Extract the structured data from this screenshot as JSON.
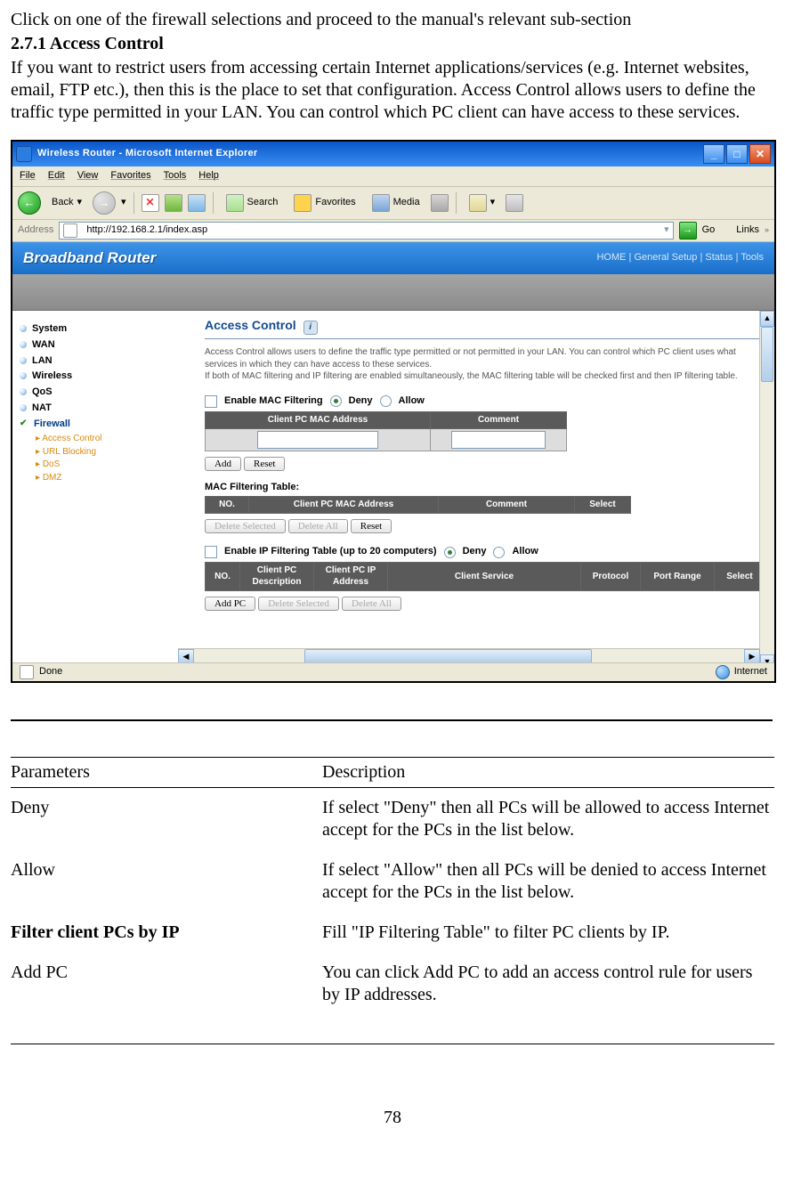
{
  "intro_line": "Click on one of the firewall selections and proceed to the manual's relevant sub-section",
  "heading": "2.7.1 Access Control",
  "paragraph": "If you want to restrict users from accessing certain Internet applications/services (e.g. Internet websites, email, FTP etc.), then this is the place to set that configuration. Access Control allows users to define the traffic type permitted in your LAN. You can control which PC client can have access to these services.",
  "title_bar": "Wireless Router - Microsoft Internet Explorer",
  "menus": {
    "file": "File",
    "edit": "Edit",
    "view": "View",
    "favorites": "Favorites",
    "tools": "Tools",
    "help": "Help"
  },
  "toolbar": {
    "back": "Back",
    "search": "Search",
    "favorites": "Favorites",
    "media": "Media"
  },
  "address": {
    "label": "Address",
    "url": "http://192.168.2.1/index.asp",
    "go": "Go",
    "links": "Links"
  },
  "banner": {
    "title": "Broadband Router",
    "links": "HOME | General Setup | Status | Tools"
  },
  "sidebar": {
    "items": [
      "System",
      "WAN",
      "LAN",
      "Wireless",
      "QoS",
      "NAT"
    ],
    "active": "Firewall",
    "sub": [
      "Access Control",
      "URL Blocking",
      "DoS",
      "DMZ"
    ]
  },
  "section": {
    "title": "Access Control",
    "desc1": "Access Control allows users to define the traffic type permitted or not permitted in your LAN. You can control which PC client uses what services in which they can have access to these services.",
    "desc2": "If both of MAC filtering and IP filtering are enabled simultaneously, the MAC filtering table will be checked first and then IP filtering table.",
    "mac": {
      "enable": "Enable MAC Filtering",
      "deny": "Deny",
      "allow": "Allow",
      "th1": "Client PC MAC Address",
      "th2": "Comment",
      "add": "Add",
      "reset": "Reset",
      "table_label": "MAC Filtering Table:",
      "tth_no": "NO.",
      "tth_addr": "Client PC MAC Address",
      "tth_comment": "Comment",
      "tth_select": "Select",
      "delsel": "Delete Selected",
      "delall": "Delete All",
      "reset2": "Reset"
    },
    "ip": {
      "enable": "Enable IP Filtering Table (up to 20 computers)",
      "deny": "Deny",
      "allow": "Allow",
      "th_no": "NO.",
      "th_desc": "Client PC Description",
      "th_ip": "Client PC IP Address",
      "th_service": "Client Service",
      "th_proto": "Protocol",
      "th_prange": "Port Range",
      "th_select": "Select",
      "addpc": "Add PC",
      "delsel": "Delete Selected",
      "delall": "Delete All"
    }
  },
  "status": {
    "done": "Done",
    "internet": "Internet"
  },
  "param_table": {
    "h1": "Parameters",
    "h2": "Description",
    "rows": [
      {
        "p": "Deny",
        "d": "If select \"Deny\" then all PCs will be allowed to access Internet accept for the PCs in the list below."
      },
      {
        "p": "Allow",
        "d": "If select \"Allow\" then all PCs will be denied to access Internet accept for the PCs in the list below."
      },
      {
        "p": "Filter client PCs by IP",
        "d": "Fill \"IP Filtering Table\" to filter PC clients by IP.",
        "bold": true
      },
      {
        "p": "Add PC",
        "d": "You can click Add PC to add an access control rule for users by IP addresses."
      }
    ]
  },
  "page_number": "78"
}
